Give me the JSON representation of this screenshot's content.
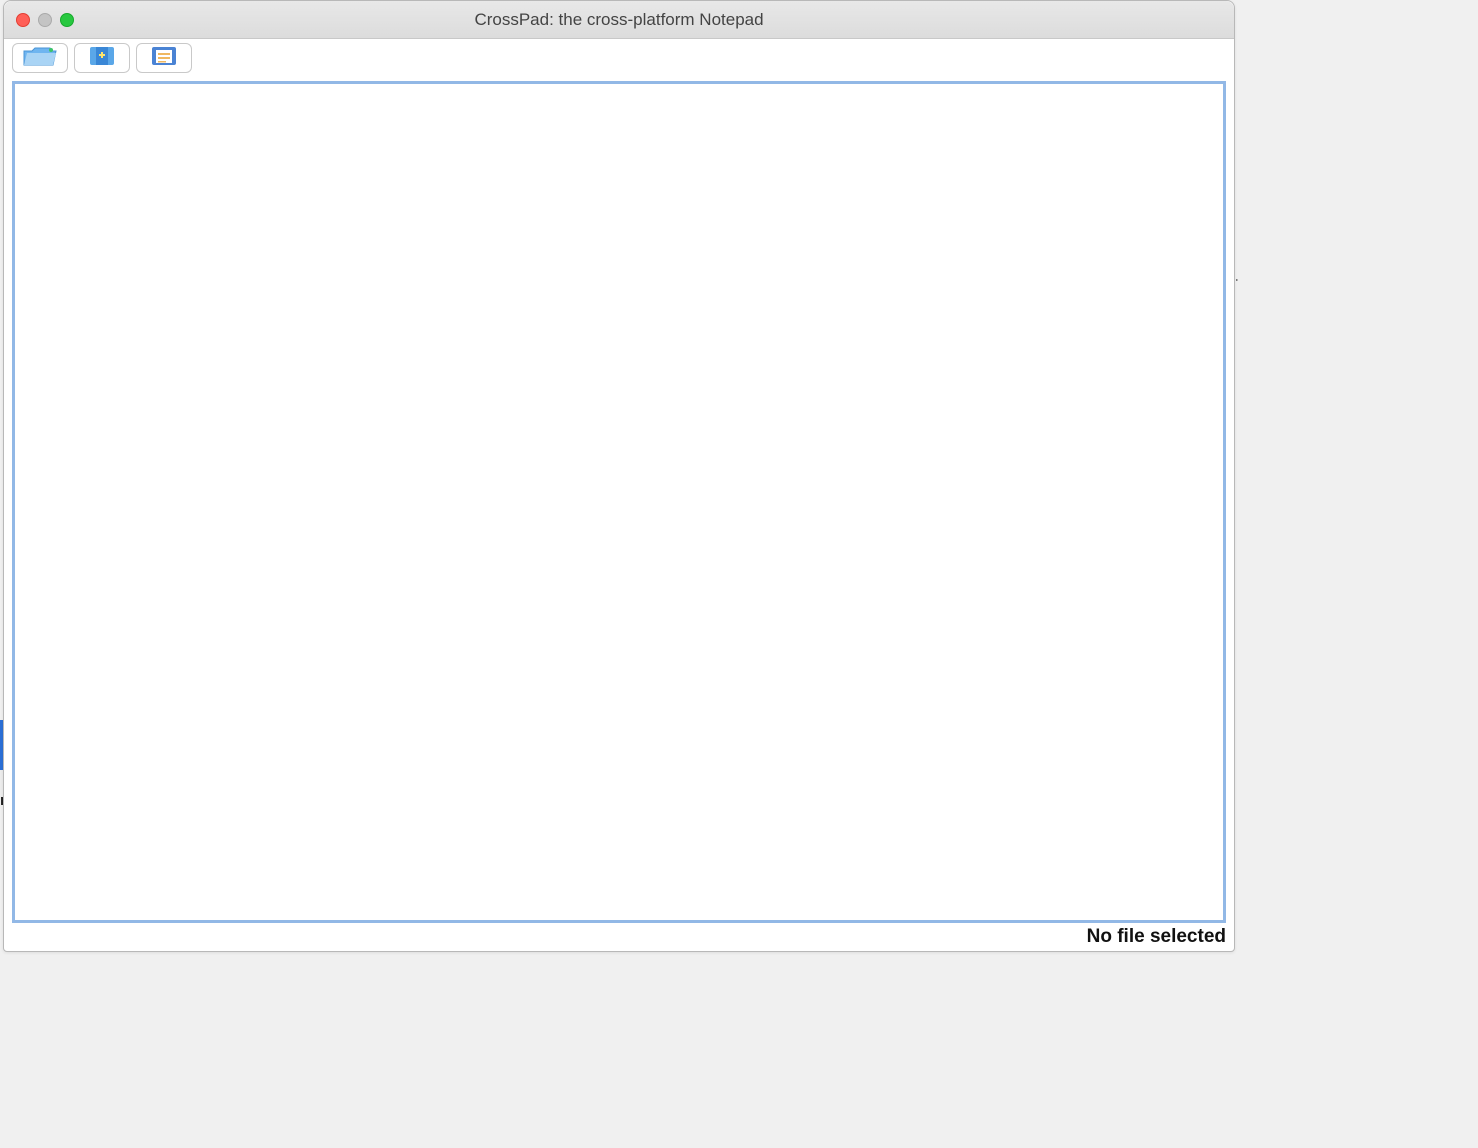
{
  "window": {
    "title": "CrossPad: the cross-platform Notepad"
  },
  "toolbar": {
    "buttons": [
      {
        "name": "open-folder",
        "icon": "open-folder-icon"
      },
      {
        "name": "new-file",
        "icon": "new-file-icon"
      },
      {
        "name": "save-file",
        "icon": "save-file-icon"
      }
    ]
  },
  "editor": {
    "content": ""
  },
  "status": {
    "message": "No file selected"
  },
  "background_peek": {
    "letter": "r"
  }
}
